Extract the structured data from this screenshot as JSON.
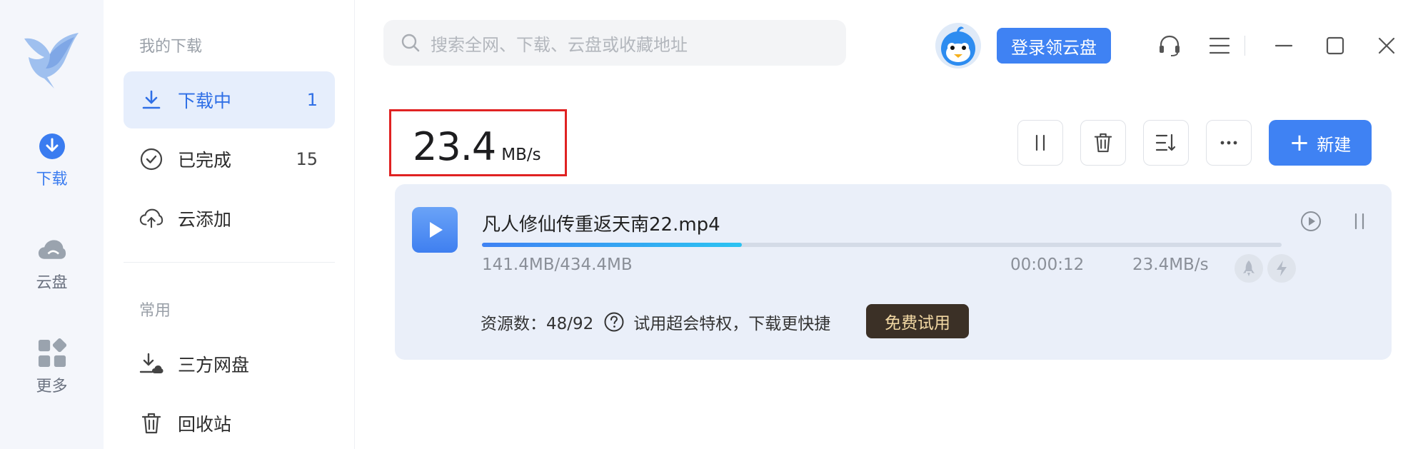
{
  "rail": {
    "items": [
      {
        "label": "下载",
        "icon": "download-circle-icon",
        "active": true
      },
      {
        "label": "云盘",
        "icon": "cloud-icon",
        "active": false
      },
      {
        "label": "更多",
        "icon": "apps-grid-icon",
        "active": false
      }
    ]
  },
  "sidebar": {
    "my_downloads_heading": "我的下载",
    "items": [
      {
        "label": "下载中",
        "count": "1",
        "icon": "download-icon"
      },
      {
        "label": "已完成",
        "count": "15",
        "icon": "check-circle-icon"
      },
      {
        "label": "云添加",
        "icon": "cloud-upload-icon"
      }
    ],
    "common_heading": "常用",
    "common_items": [
      {
        "label": "三方网盘",
        "icon": "third-party-drive-icon"
      },
      {
        "label": "回收站",
        "icon": "trash-icon"
      }
    ]
  },
  "header": {
    "search_placeholder": "搜索全网、下载、云盘或收藏地址",
    "login_label": "登录领云盘"
  },
  "speed": {
    "value": "23.4",
    "unit": "MB/s"
  },
  "toolbar": {
    "new_label": "新建"
  },
  "task": {
    "file_name": "凡人修仙传重返天南22.mp4",
    "progress": 0.325,
    "size": "141.4MB/434.4MB",
    "time_left": "00:00:12",
    "rate": "23.4MB/s",
    "sources_label": "资源数：48/92",
    "promo": "试用超会特权，下载更快捷",
    "trial_label": "免费试用"
  },
  "colors": {
    "accent": "#3f82f3",
    "highlight_border": "#e02222",
    "trial_bg": "#3b3026",
    "trial_text": "#f3d9a4"
  }
}
